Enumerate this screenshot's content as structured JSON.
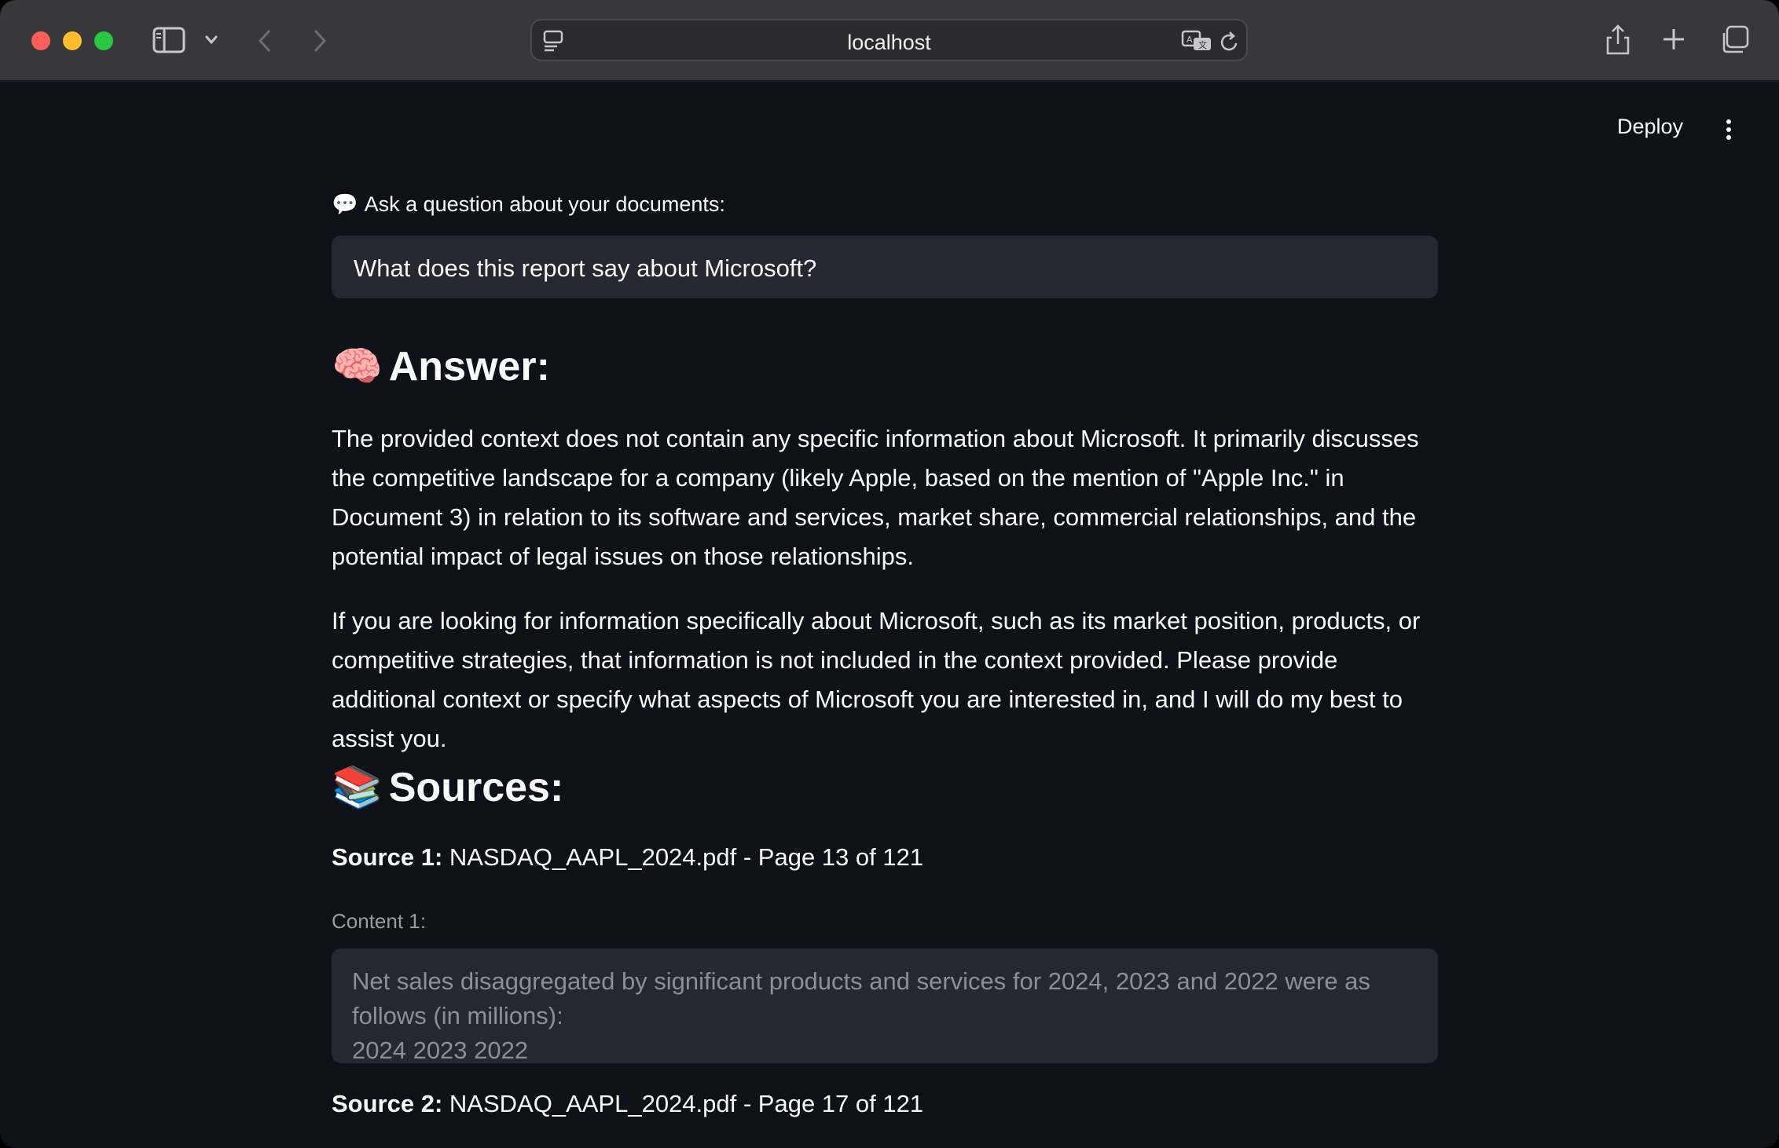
{
  "browser": {
    "url": "localhost",
    "icons": {
      "sidebar": "sidebar-toggle-icon",
      "chevron": "chevron-down-icon",
      "back": "back-arrow-icon",
      "forward": "forward-arrow-icon",
      "page_menu": "page-menu-icon",
      "translate": "translate-icon",
      "reload": "reload-icon",
      "share": "share-icon",
      "new_tab": "plus-icon",
      "tabs": "tab-overview-icon"
    }
  },
  "header": {
    "deploy_label": "Deploy",
    "menu_icon": "kebab-menu-icon"
  },
  "query": {
    "label": "Ask a question about your documents:",
    "label_emoji": "💬",
    "value": "What does this report say about Microsoft?"
  },
  "answer": {
    "emoji": "🧠",
    "heading": "Answer:",
    "paragraphs": [
      "The provided context does not contain any specific information about Microsoft. It primarily discusses the competitive landscape for a company (likely Apple, based on the mention of \"Apple Inc.\" in Document 3) in relation to its software and services, market share, commercial relationships, and the potential impact of legal issues on those relationships.",
      "If you are looking for information specifically about Microsoft, such as its market position, products, or competitive strategies, that information is not included in the context provided. Please provide additional context or specify what aspects of Microsoft you are interested in, and I will do my best to assist you."
    ]
  },
  "sources": {
    "emoji": "📚",
    "heading": "Sources:",
    "items": [
      {
        "label": "Source 1:",
        "file": "NASDAQ_AAPL_2024.pdf - Page 13 of 121",
        "content_label": "Content 1:",
        "content": "Net sales disaggregated by significant products and services for 2024, 2023 and 2022 were as follows (in millions):\n2024 2023 2022"
      },
      {
        "label": "Source 2:",
        "file": "NASDAQ_AAPL_2024.pdf - Page 17 of 121"
      }
    ]
  },
  "colors": {
    "background": "#0e1117",
    "input_bg": "#262730",
    "text": "#fafafa",
    "muted": "#9a9ba3",
    "toolbar": "#38383a"
  }
}
